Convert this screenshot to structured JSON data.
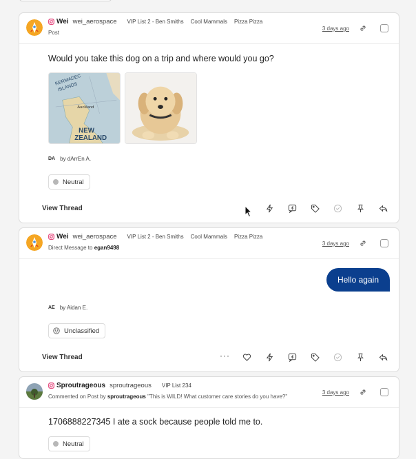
{
  "posts": [
    {
      "author": "Wei",
      "handle": "wei_aerospace",
      "lists": [
        "VIP List 2 - Ben Smiths",
        "Cool Mammals",
        "Pizza Pizza"
      ],
      "type_label": "Post",
      "time": "3 days ago",
      "text": "Would you take this dog on a trip and where would you go?",
      "images": [
        "map-image",
        "puppy-image"
      ],
      "assignee_initials": "DA",
      "assignee": "by dArrEn A.",
      "sentiment": "Neutral",
      "view_thread": "View Thread"
    },
    {
      "author": "Wei",
      "handle": "wei_aerospace",
      "lists": [
        "VIP List 2 - Ben Smiths",
        "Cool Mammals",
        "Pizza Pizza"
      ],
      "subline_prefix": "Direct Message to",
      "subline_user": "egan9498",
      "time": "3 days ago",
      "message": "Hello again",
      "assignee_initials": "AE",
      "assignee": "by Aidan E.",
      "sentiment": "Unclassified",
      "view_thread": "View Thread",
      "more": "···"
    },
    {
      "author": "Sproutrageous",
      "handle": "sproutrageous",
      "lists": [
        "VIP List 234"
      ],
      "subline_prefix": "Commented on Post by",
      "subline_user": "sproutrageous",
      "subline_quote": "\"This is WILD! What customer care stories do you have?\"",
      "time": "3 days ago",
      "text": "1706888227345 I ate a sock because people told me to.",
      "sentiment": "Neutral"
    }
  ],
  "colors": {
    "accent": "#0b3f8e",
    "instagram": "#e1306c"
  },
  "icons": [
    "instagram-icon",
    "link-icon",
    "like-icon",
    "bolt-icon",
    "reply-bubble-icon",
    "tag-icon",
    "check-circle-icon",
    "pin-icon",
    "reply-icon"
  ]
}
